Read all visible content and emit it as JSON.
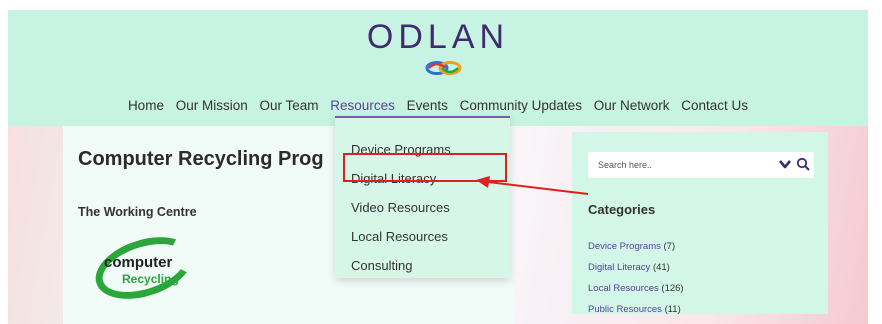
{
  "header": {
    "logo_text": "ODLAN"
  },
  "nav": {
    "items": [
      "Home",
      "Our Mission",
      "Our Team",
      "Resources",
      "Events",
      "Community Updates",
      "Our Network",
      "Contact Us"
    ],
    "active": "Resources"
  },
  "dropdown": {
    "items": [
      "Device Programs",
      "Digital Literacy",
      "Video Resources",
      "Local Resources",
      "Consulting"
    ],
    "highlighted": "Digital Literacy"
  },
  "main": {
    "title": "Computer Recycling Prog",
    "org_name": "The Working Centre",
    "logo_text_1": "computer",
    "logo_text_2": "Recycling"
  },
  "sidebar": {
    "search_placeholder": "Search here..",
    "categories_heading": "Categories",
    "categories": [
      {
        "label": "Device Programs",
        "count": "(7)"
      },
      {
        "label": "Digital Literacy",
        "count": "(41)"
      },
      {
        "label": "Local Resources",
        "count": "(126)"
      },
      {
        "label": "Public Resources",
        "count": "(11)"
      }
    ]
  },
  "colors": {
    "header_bg": "#c7f3e2",
    "brand_purple": "#3f2c6e",
    "link_purple": "#5b3f98",
    "annotation_red": "#e01f1f",
    "logo_green": "#2aa63a"
  }
}
